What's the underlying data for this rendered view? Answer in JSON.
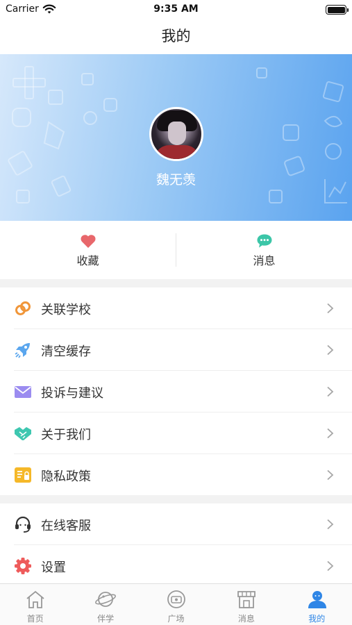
{
  "status_bar": {
    "carrier": "Carrier",
    "time": "9:35 AM"
  },
  "nav": {
    "title": "我的"
  },
  "profile": {
    "name": "魏无羡"
  },
  "quick_actions": [
    {
      "label": "收藏",
      "icon": "heart-icon",
      "color": "#e8676b"
    },
    {
      "label": "消息",
      "icon": "chat-bubble-icon",
      "color": "#3cc6a8"
    }
  ],
  "menu_group_1": [
    {
      "label": "关联学校",
      "icon": "link-icon",
      "color": "#f0963a"
    },
    {
      "label": "清空缓存",
      "icon": "rocket-icon",
      "color": "#5aa6ee"
    },
    {
      "label": "投诉与建议",
      "icon": "envelope-icon",
      "color": "#9b8cf0"
    },
    {
      "label": "关于我们",
      "icon": "handshake-icon",
      "color": "#3ec7b0"
    },
    {
      "label": "隐私政策",
      "icon": "policy-document-icon",
      "color": "#f5b829"
    }
  ],
  "menu_group_2": [
    {
      "label": "在线客服",
      "icon": "headset-icon",
      "color": "#333333"
    },
    {
      "label": "设置",
      "icon": "gear-icon",
      "color": "#ee5b5b"
    }
  ],
  "tab_bar": {
    "active_color": "#2f86e6",
    "items": [
      {
        "label": "首页",
        "icon": "home-icon"
      },
      {
        "label": "伴学",
        "icon": "planet-icon"
      },
      {
        "label": "广场",
        "icon": "square-icon"
      },
      {
        "label": "消息",
        "icon": "shop-icon"
      },
      {
        "label": "我的",
        "icon": "user-icon",
        "active": true
      }
    ]
  }
}
